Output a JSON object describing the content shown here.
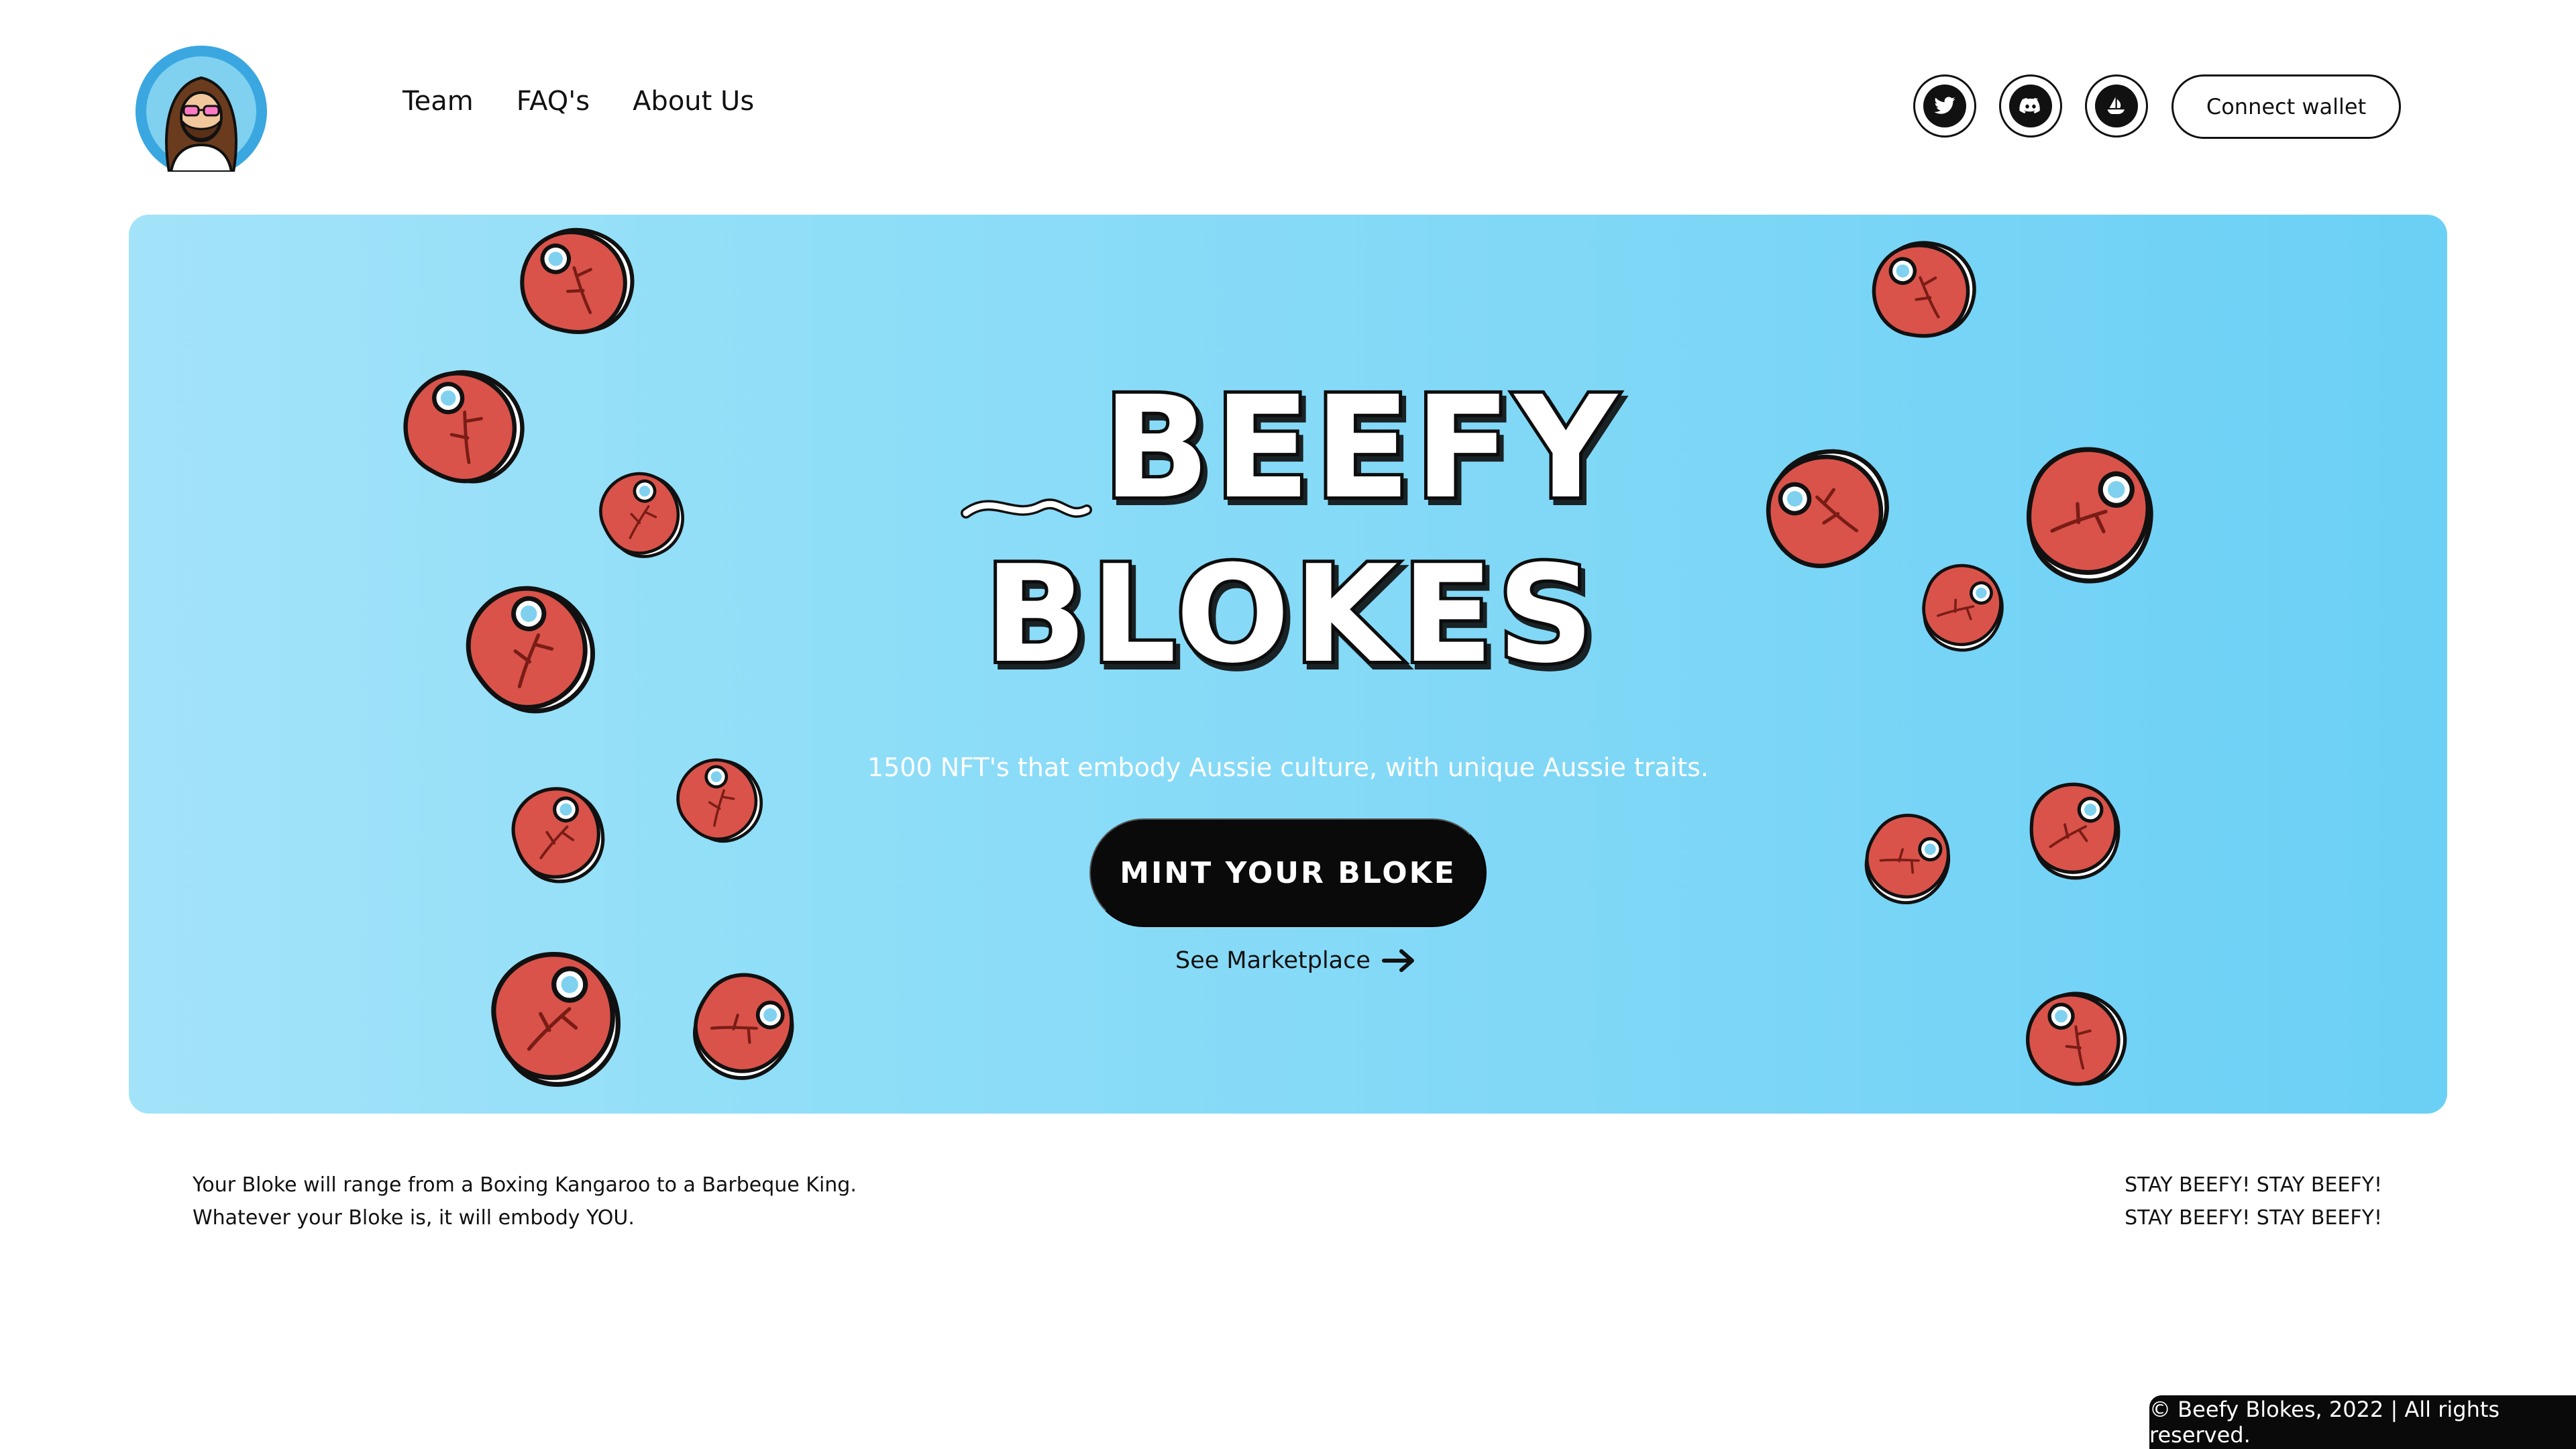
{
  "header": {
    "nav": [
      {
        "label": "Team"
      },
      {
        "label": "FAQ's"
      },
      {
        "label": "About Us"
      }
    ],
    "social": [
      {
        "icon": "twitter-icon"
      },
      {
        "icon": "discord-icon"
      },
      {
        "icon": "opensea-icon"
      }
    ],
    "connect_label": "Connect wallet"
  },
  "hero": {
    "title_line1": "BEEFY",
    "title_line2": "BLOKES",
    "tagline": "1500 NFT's that embody Aussie culture, with unique Aussie traits.",
    "cta_label": "MINT YOUR BLOKE",
    "secondary_link": "See Marketplace",
    "background_colors": [
      "#a3e3f9",
      "#6bd0f5"
    ]
  },
  "info": {
    "description_lines": [
      "Your Bloke will range from a Boxing Kangaroo to a Barbeque King.",
      "Whatever your Bloke is, it will embody YOU."
    ],
    "slogan_lines": [
      "STAY BEEFY! STAY BEEFY!",
      "STAY BEEFY! STAY BEEFY!"
    ]
  },
  "footer": {
    "copyright": "© Beefy Blokes, 2022 | All rights reserved."
  },
  "colors": {
    "accent_black": "#0a0a0a",
    "steak_red": "#d9534a",
    "bone_blue": "#7fd1ef"
  }
}
